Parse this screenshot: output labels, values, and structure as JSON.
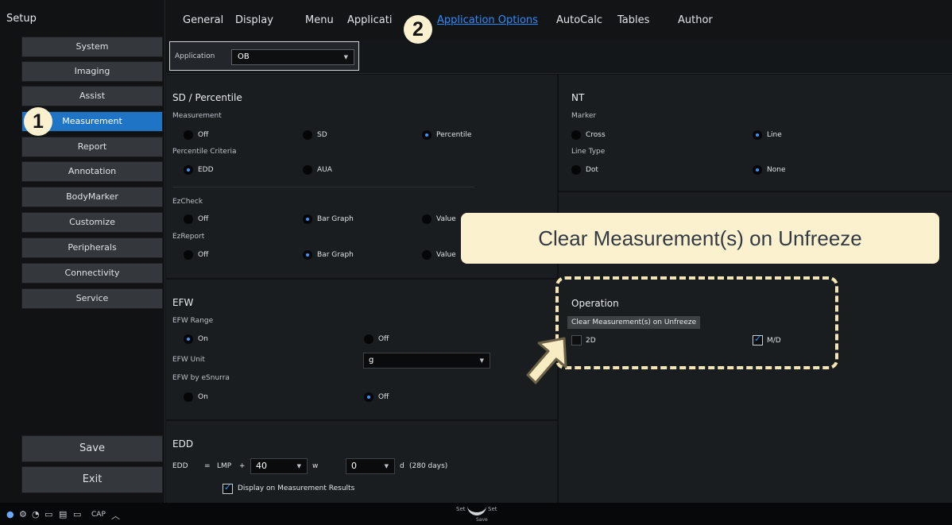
{
  "setup_title": "Setup",
  "sidebar": {
    "items": [
      {
        "label": "System"
      },
      {
        "label": "Imaging"
      },
      {
        "label": "Assist"
      },
      {
        "label": "Measurement"
      },
      {
        "label": "Report"
      },
      {
        "label": "Annotation"
      },
      {
        "label": "BodyMarker"
      },
      {
        "label": "Customize"
      },
      {
        "label": "Peripherals"
      },
      {
        "label": "Connectivity"
      },
      {
        "label": "Service"
      }
    ],
    "save_label": "Save",
    "exit_label": "Exit"
  },
  "tabs": [
    {
      "label": "General"
    },
    {
      "label": "Display"
    },
    {
      "label": "Menu"
    },
    {
      "label": "Applicati"
    },
    {
      "label": "Application Options"
    },
    {
      "label": "AutoCalc"
    },
    {
      "label": "Tables"
    },
    {
      "label": "Author"
    }
  ],
  "application": {
    "label": "Application",
    "value": "OB"
  },
  "sd_percentile": {
    "title": "SD / Percentile",
    "measurement_label": "Measurement",
    "measurement_options": [
      "Off",
      "SD",
      "Percentile"
    ],
    "measurement_selected": "Percentile",
    "criteria_label": "Percentile Criteria",
    "criteria_options": [
      "EDD",
      "AUA"
    ],
    "criteria_selected": "EDD"
  },
  "ezcheck": {
    "label": "EzCheck",
    "options": [
      "Off",
      "Bar Graph",
      "Value"
    ],
    "selected": "Bar Graph"
  },
  "ezreport": {
    "label": "EzReport",
    "options": [
      "Off",
      "Bar Graph",
      "Value"
    ],
    "selected": "Bar Graph"
  },
  "efw": {
    "title": "EFW",
    "range_label": "EFW Range",
    "range_options": [
      "On",
      "Off"
    ],
    "range_selected": "On",
    "unit_label": "EFW Unit",
    "unit_value": "g",
    "esnurra_label": "EFW by eSnurra",
    "esnurra_options": [
      "On",
      "Off"
    ],
    "esnurra_selected": "Off"
  },
  "edd": {
    "title": "EDD",
    "edd_label": "EDD",
    "eq_sign": "=",
    "lmp_label": "LMP",
    "plus_sign": "+",
    "weeks_value": "40",
    "weeks_unit": "w",
    "days_value": "0",
    "days_unit": "d",
    "total": "(280 days)",
    "display_label": "Display on Measurement Results",
    "display_checked": true
  },
  "nt": {
    "title": "NT",
    "marker_label": "Marker",
    "marker_options": [
      "Cross",
      "Line"
    ],
    "marker_selected": "Line",
    "linetype_label": "Line Type",
    "linetype_options": [
      "Dot",
      "None"
    ],
    "linetype_selected": "None"
  },
  "operation": {
    "title": "Operation",
    "tooltip": "Clear Measurement(s) on Unfreeze",
    "opt_2d_label": "2D",
    "opt_2d_checked": false,
    "opt_md_label": "M/D",
    "opt_md_checked": true
  },
  "annotations": {
    "badge_1": "1",
    "badge_2": "2",
    "callout": "Clear Measurement(s) on Unfreeze"
  },
  "statusbar": {
    "caps": "CAP",
    "set_left": "Set",
    "set_right": "Set",
    "save": "Save"
  },
  "colors": {
    "accent": "#1f74c6",
    "link": "#2a8cff",
    "callout_bg": "#fbf1cf"
  }
}
